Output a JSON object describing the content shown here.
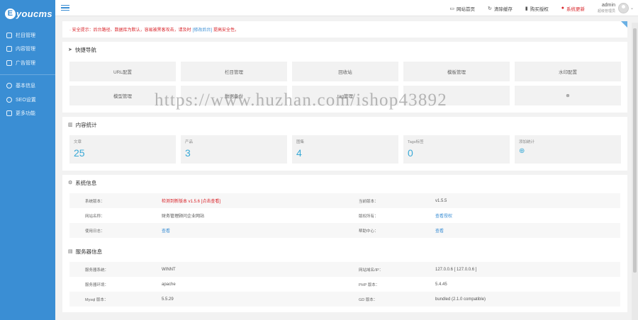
{
  "app": {
    "logo_mark": "E",
    "logo_text": "youcms"
  },
  "sidebar": {
    "items": [
      {
        "label": "栏目管理",
        "icon": "folder-icon"
      },
      {
        "label": "内容管理",
        "icon": "document-icon"
      },
      {
        "label": "广告管理",
        "icon": "image-icon"
      }
    ],
    "items2": [
      {
        "label": "基本信息",
        "icon": "settings-icon"
      },
      {
        "label": "SEO设置",
        "icon": "seo-icon"
      },
      {
        "label": "更多功能",
        "icon": "apps-icon"
      }
    ]
  },
  "topbar": {
    "links": [
      {
        "label": "网站首页",
        "icon": "monitor-icon",
        "glyph": "▭"
      },
      {
        "label": "清除缓存",
        "icon": "refresh-icon",
        "glyph": "↻"
      },
      {
        "label": "购买授权",
        "icon": "bookmark-icon",
        "glyph": "▮"
      },
      {
        "label": "系统更新",
        "icon": "alert-icon",
        "glyph": "●"
      }
    ],
    "user_name": "admin",
    "user_role": "超级管理员"
  },
  "warning": {
    "text_before": "· 安全提示：后台路径、数据库为默认，容易被黑客攻击，请及时",
    "link": "[修改后台]",
    "text_after": "提高安全性。"
  },
  "quick_nav": {
    "title": "快捷导航",
    "buttons": [
      "URL配置",
      "栏目管理",
      "回收站",
      "模板管理",
      "水印配置",
      "模型管理",
      "数据备份",
      "tag管理",
      "",
      "⊕"
    ]
  },
  "stats": {
    "title": "内容统计",
    "items": [
      {
        "label": "文章",
        "value": "25"
      },
      {
        "label": "产品",
        "value": "3"
      },
      {
        "label": "图集",
        "value": "4"
      },
      {
        "label": "Tags标签",
        "value": "0"
      },
      {
        "label": "添加统计",
        "value": "⊕"
      }
    ]
  },
  "system_info": {
    "title": "系统信息",
    "rows": [
      {
        "k1": "系统版本：",
        "v1": "检测到新版本 v1.5.6 [点击查看]",
        "k2": "当前版本：",
        "v2": "v1.5.5"
      },
      {
        "k1": "网站名称：",
        "v1": "财务管理顾问企业网站",
        "k2": "版权所有：",
        "v2": "查看授权"
      },
      {
        "k1": "使用日志：",
        "v1": "查看",
        "k2": "帮助中心：",
        "v2": "查看"
      }
    ]
  },
  "server_info": {
    "title": "服务器信息",
    "rows": [
      {
        "k1": "服务器系统：",
        "v1": "WINNT",
        "k2": "网站域名/IP：",
        "v2": "127.0.0.6 [ 127.0.0.6 ]"
      },
      {
        "k1": "服务器环境：",
        "v1": "apache",
        "k2": "PHP 版本：",
        "v2": "5.4.45"
      },
      {
        "k1": "Mysql 版本：",
        "v1": "5.5.29",
        "k2": "GD 版本：",
        "v2": "bundled (2.1.0 compatible)"
      }
    ]
  },
  "watermark": {
    "text": "https://www.huzhan.com/ishop43892"
  },
  "colors": {
    "sidebar": "#3a8ed4",
    "accent": "#3aa9d6",
    "alert": "#d9242a"
  }
}
